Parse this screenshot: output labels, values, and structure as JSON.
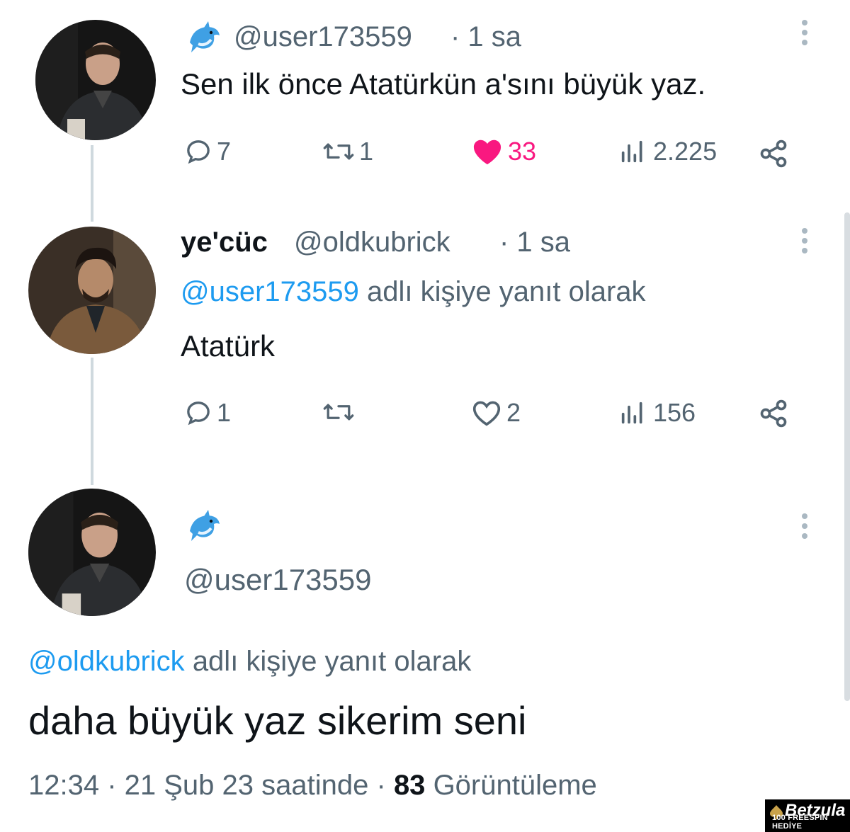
{
  "tweets": [
    {
      "handle": "@user173559",
      "time": "· 1 sa",
      "text": "Sen ilk önce Atatürkün a'sını büyük yaz.",
      "replies": "7",
      "retweets": "1",
      "likes": "33",
      "liked": true,
      "views": "2.225"
    },
    {
      "display_name": "ye'cüc",
      "handle": "@oldkubrick",
      "time": "· 1 sa",
      "reply_to_handle": "@user173559",
      "reply_to_suffix": "adlı kişiye yanıt olarak",
      "text": "Atatürk",
      "replies": "1",
      "retweets": "",
      "likes": "2",
      "liked": false,
      "views": "156"
    },
    {
      "handle": "@user173559",
      "reply_to_handle": "@oldkubrick",
      "reply_to_suffix": "adlı kişiye yanıt olarak",
      "text": "daha büyük yaz sikerim seni",
      "timestamp": "12:34 · 21 Şub 23 saatinde ·",
      "view_count": "83",
      "view_label": "Görüntüleme"
    }
  ],
  "watermark": {
    "brand": "Betzula",
    "tagline": "100 FREESPIN HEDİYE"
  },
  "colors": {
    "text": "#0f1419",
    "secondary": "#536471",
    "link": "#1d9bf0",
    "like": "#f91880",
    "thread_line": "#cfd9de"
  },
  "icons": [
    "dolphin-emoji-icon",
    "reply-icon",
    "retweet-icon",
    "heart-icon",
    "views-icon",
    "share-icon",
    "more-icon",
    "betzula-spade-icon"
  ]
}
